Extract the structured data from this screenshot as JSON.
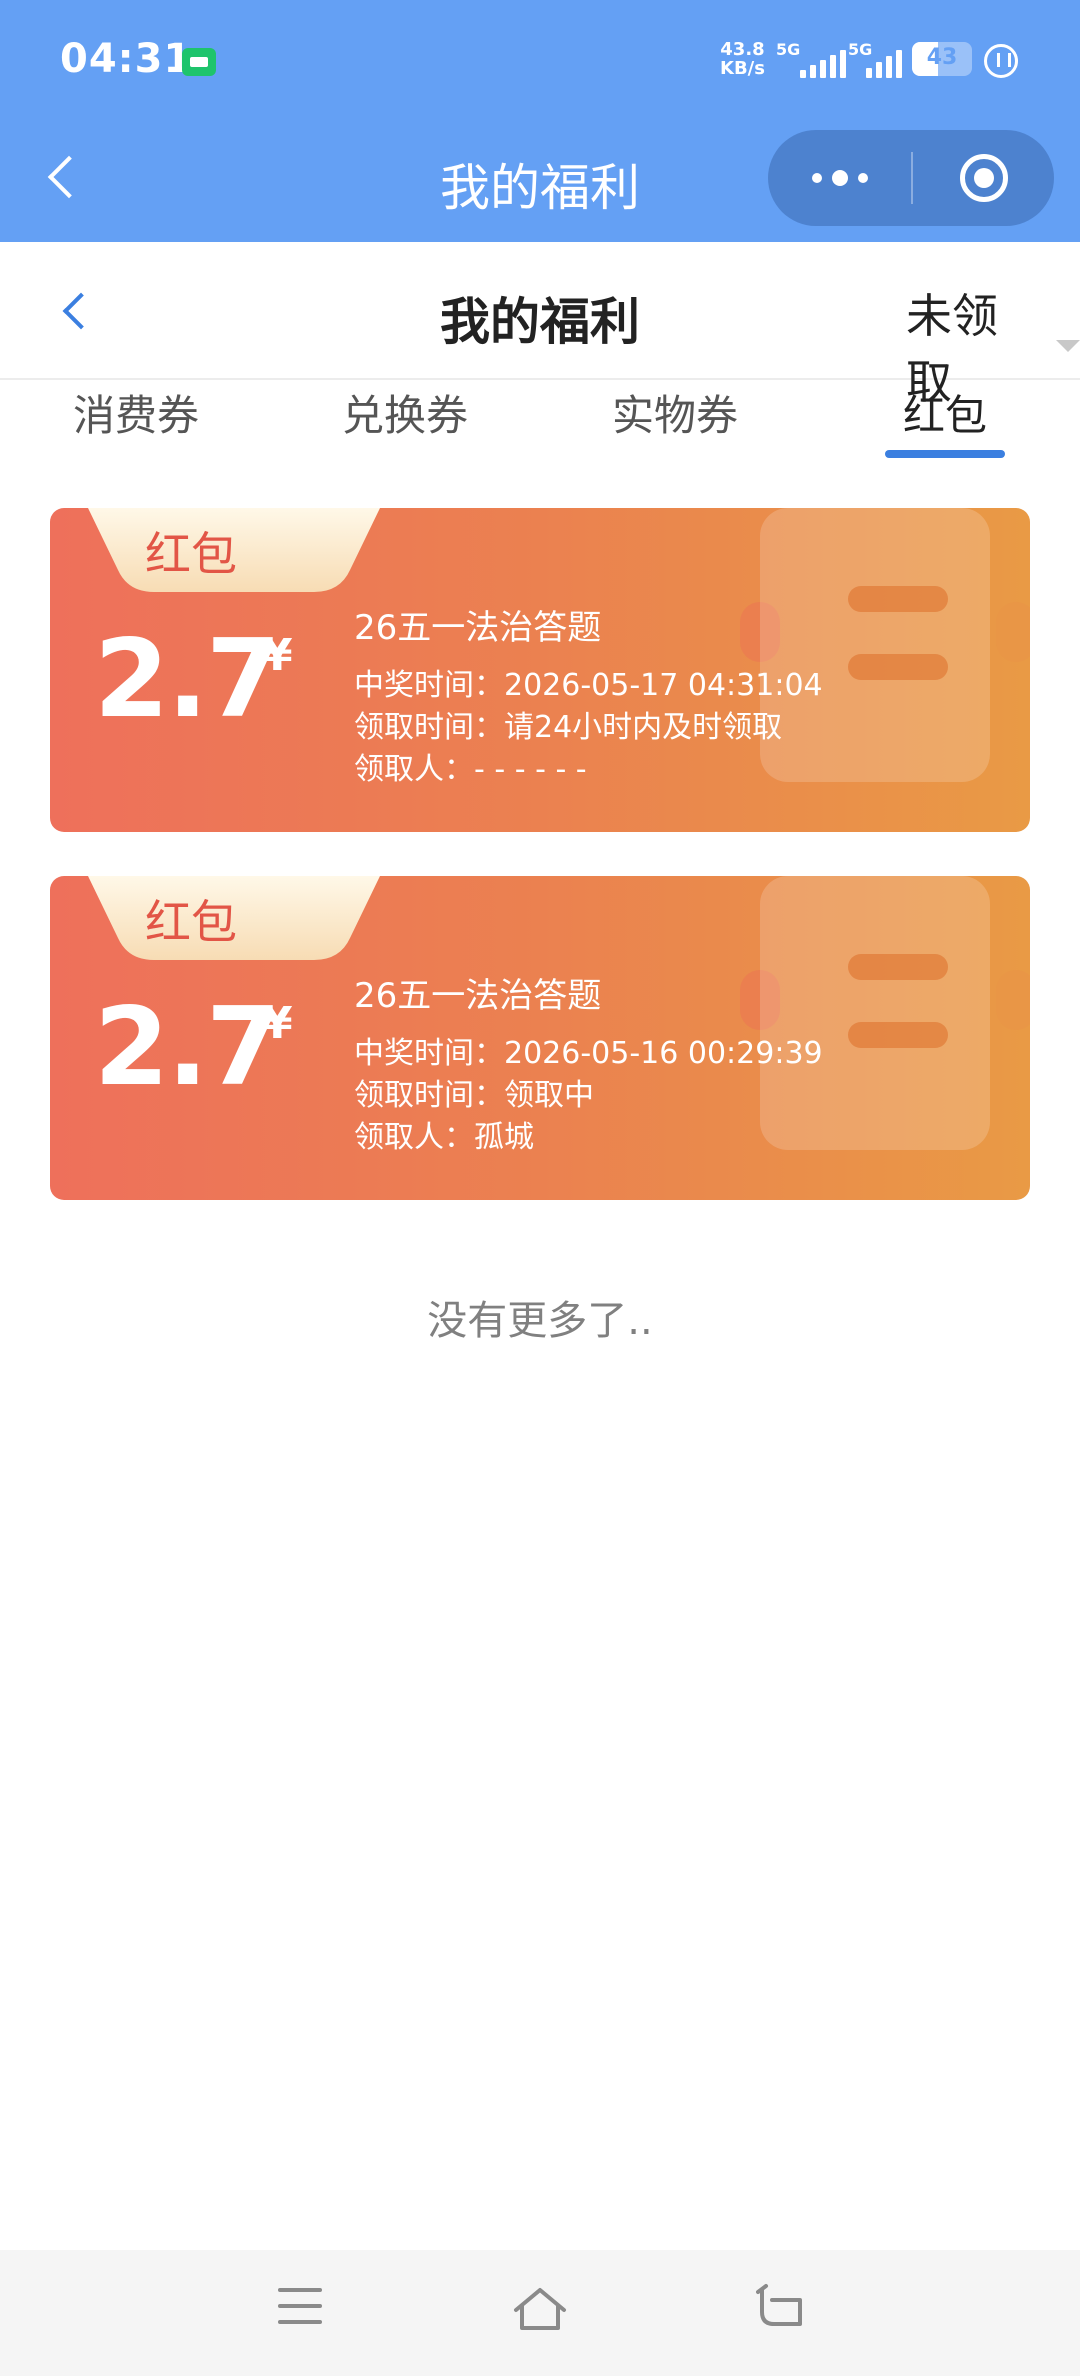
{
  "status_bar": {
    "time": "04:31",
    "net_speed_value": "43.8",
    "net_speed_unit": "KB/s",
    "signal1": "5G",
    "signal2": "5G",
    "battery": "43",
    "battery_level": 0.43
  },
  "miniprogram_bar": {
    "title": "我的福利",
    "more_icon": "more-dots-icon",
    "close_icon": "target-close-icon"
  },
  "page_header": {
    "title": "我的福利",
    "filter_label": "未领取"
  },
  "tabs": [
    {
      "label": "消费券",
      "active": false
    },
    {
      "label": "兑换券",
      "active": false
    },
    {
      "label": "实物券",
      "active": false
    },
    {
      "label": "红包",
      "active": true
    }
  ],
  "cards": [
    {
      "ribbon": "红包",
      "amount": "2.7",
      "currency": "¥",
      "name": "26五一法治答题",
      "win_time": "中奖时间：2026-05-17 04:31:04",
      "claim_time": "领取时间：请24小时内及时领取",
      "claimer": "领取人：- - - - - -"
    },
    {
      "ribbon": "红包",
      "amount": "2.7",
      "currency": "¥",
      "name": "26五一法治答题",
      "win_time": "中奖时间：2026-05-16 00:29:39",
      "claim_time": "领取时间：领取中",
      "claimer": "领取人：孤城"
    }
  ],
  "no_more_text": "没有更多了..",
  "colors": {
    "header_blue": "#64a0f4",
    "accent_blue": "#3b7fe0",
    "card_start": "#ee705b",
    "card_end": "#e99a45",
    "ribbon_text": "#e25546"
  }
}
